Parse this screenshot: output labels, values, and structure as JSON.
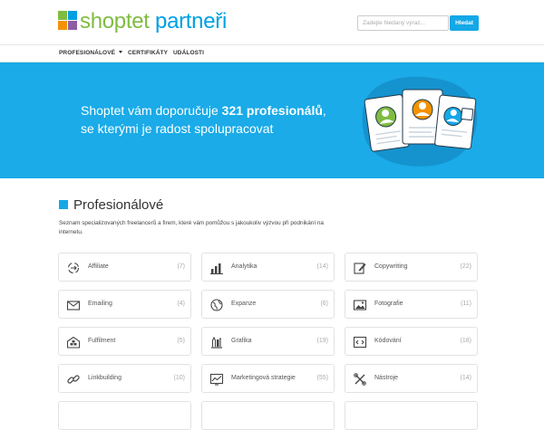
{
  "brand": {
    "logo_text_left": "shoptet",
    "logo_text_right": "partneři",
    "colors": {
      "green": "#7fbc41",
      "blue": "#00a0e3",
      "orange": "#f39200",
      "purple": "#8e5ea2",
      "accent": "#14a8e7"
    }
  },
  "search": {
    "placeholder": "Zadejte hledaný výraz...",
    "button_label": "Hledat"
  },
  "nav": {
    "items": [
      {
        "label": "PROFESIONÁLOVÉ",
        "has_dropdown": true
      },
      {
        "label": "CERTIFIKÁTY",
        "has_dropdown": false
      },
      {
        "label": "UDÁLOSTI",
        "has_dropdown": false
      }
    ]
  },
  "hero": {
    "line1_prefix": "Shoptet vám doporučuje ",
    "line1_bold": "321 profesionálů",
    "line1_suffix": ",",
    "line2": "se kterými je radost spolupracovat",
    "background": "#1aabe8"
  },
  "section": {
    "title": "Profesionálové",
    "description": "Seznam specializovaných freelancerů a firem, které vám pomůžou s jakoukoliv výzvou při podnikání na internetu."
  },
  "categories": [
    {
      "label": "Affiliate",
      "count": "(7)",
      "icon": "affiliate-icon"
    },
    {
      "label": "Analytika",
      "count": "(14)",
      "icon": "analytics-chart-icon"
    },
    {
      "label": "Copywriting",
      "count": "(22)",
      "icon": "pencil-edit-icon"
    },
    {
      "label": "Emailing",
      "count": "(4)",
      "icon": "envelope-icon"
    },
    {
      "label": "Expanze",
      "count": "(6)",
      "icon": "globe-icon"
    },
    {
      "label": "Fotografie",
      "count": "(11)",
      "icon": "image-icon"
    },
    {
      "label": "Fulfilment",
      "count": "(5)",
      "icon": "warehouse-icon"
    },
    {
      "label": "Grafika",
      "count": "(19)",
      "icon": "design-tools-icon"
    },
    {
      "label": "Kódování",
      "count": "(18)",
      "icon": "code-icon"
    },
    {
      "label": "Linkbuilding",
      "count": "(10)",
      "icon": "link-icon"
    },
    {
      "label": "Marketingová strategie",
      "count": "(55)",
      "icon": "strategy-chart-icon"
    },
    {
      "label": "Nástroje",
      "count": "(14)",
      "icon": "tools-icon"
    },
    {
      "label": "",
      "count": "",
      "icon": ""
    },
    {
      "label": "",
      "count": "",
      "icon": ""
    },
    {
      "label": "",
      "count": "",
      "icon": ""
    }
  ]
}
